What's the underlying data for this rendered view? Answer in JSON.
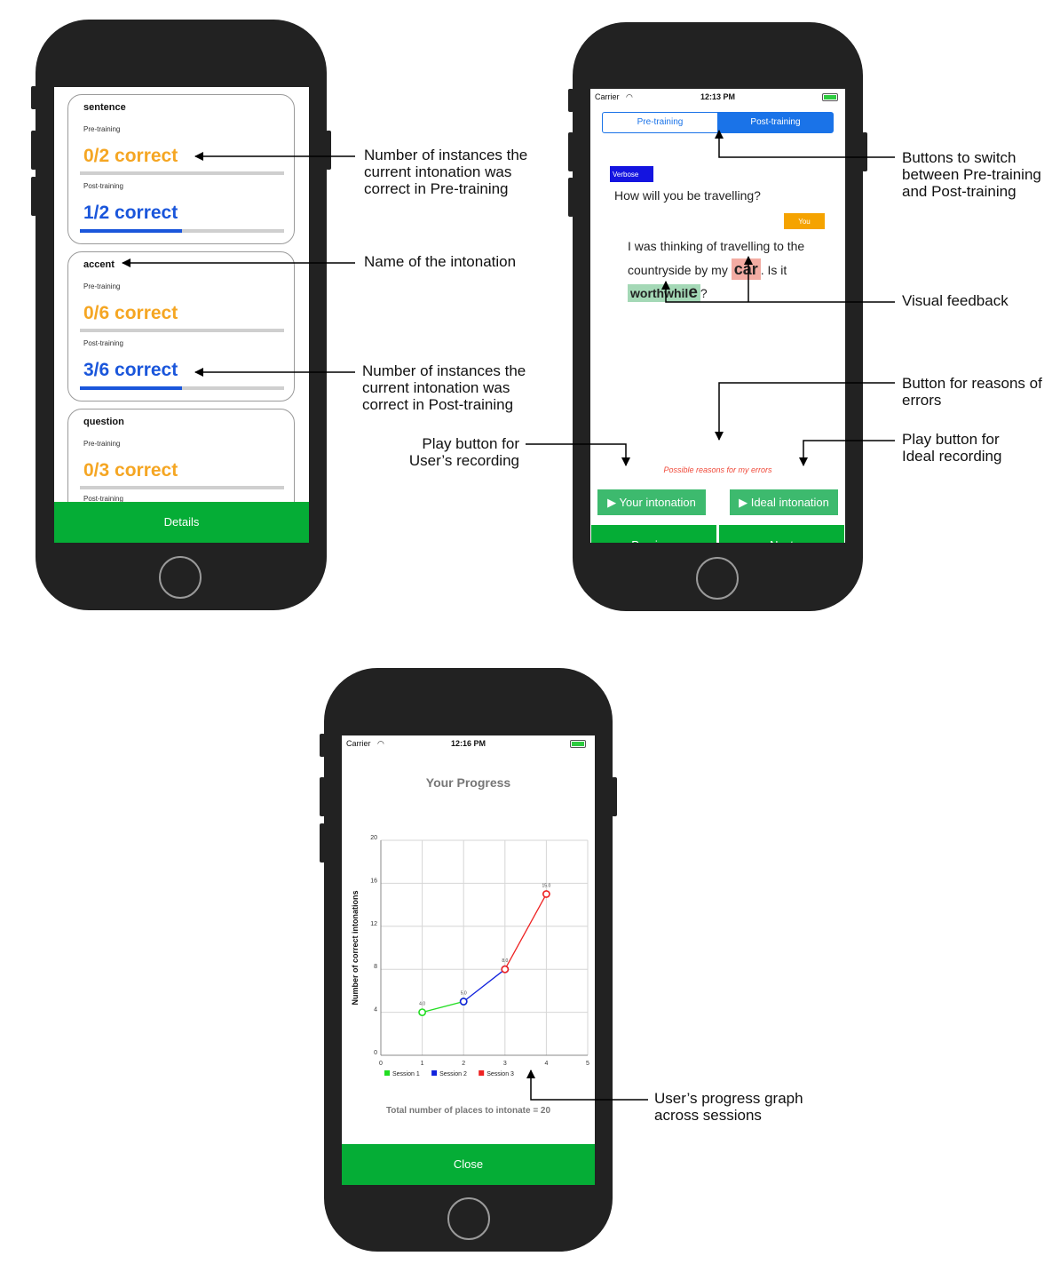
{
  "screen1": {
    "cards": [
      {
        "title": "sentence",
        "pre_label": "Pre-training",
        "pre_score": "0/2 correct",
        "post_label": "Post-training",
        "post_score": "1/2 correct",
        "pre_fraction": 0,
        "post_fraction": 0.5
      },
      {
        "title": "accent",
        "pre_label": "Pre-training",
        "pre_score": "0/6 correct",
        "post_label": "Post-training",
        "post_score": "3/6 correct",
        "pre_fraction": 0,
        "post_fraction": 0.5
      },
      {
        "title": "question",
        "pre_label": "Pre-training",
        "pre_score": "0/3 correct",
        "post_label": "Post-training",
        "pre_fraction": 0
      }
    ],
    "details_button": "Details"
  },
  "screen2": {
    "carrier": "Carrier",
    "time": "12:13 PM",
    "tabs": [
      "Pre-training",
      "Post-training"
    ],
    "verbose_tag": "Verbose",
    "question": "How will you be travelling?",
    "you_tag": "You",
    "answer_part1": "I was thinking of travelling to the countryside by my ",
    "answer_hl1": "car",
    "answer_part2": ". Is it ",
    "answer_hl2_a": "worthwhil",
    "answer_hl2_b": "e",
    "answer_part3": "?",
    "reasons_link": "Possible reasons for my errors",
    "your_intonation": "▶ Your intonation",
    "ideal_intonation": "▶ Ideal intonation",
    "previous": "Previous",
    "next": "Next"
  },
  "screen3": {
    "carrier": "Carrier",
    "time": "12:16 PM",
    "title": "Your Progress",
    "total_text": "Total number of places to intonate = 20",
    "close_button": "Close"
  },
  "chart_data": {
    "type": "line",
    "ylabel": "Number of correct intonations",
    "xlabel": "",
    "xlim": [
      0,
      5
    ],
    "ylim": [
      0,
      20
    ],
    "x_ticks": [
      "0",
      "1",
      "2",
      "3",
      "4",
      "5"
    ],
    "y_ticks": [
      "0",
      "4",
      "8",
      "12",
      "16",
      "20"
    ],
    "grid": true,
    "legend": "bottom",
    "series": [
      {
        "name": "Session 1",
        "color": "#22dd22",
        "x": [
          1,
          2
        ],
        "y": [
          4.0,
          5.0
        ],
        "labels": [
          "4.0",
          "5.0"
        ]
      },
      {
        "name": "Session 2",
        "color": "#1122dd",
        "x": [
          2,
          3
        ],
        "y": [
          5.0,
          8.0
        ],
        "labels": [
          "",
          "8.0"
        ]
      },
      {
        "name": "Session 3",
        "color": "#ee2222",
        "x": [
          3,
          4
        ],
        "y": [
          8.0,
          15.0
        ],
        "labels": [
          "",
          "15.0"
        ]
      }
    ]
  },
  "annotations": {
    "pre_count": "Number of instances the current intonation was correct in Pre-training",
    "name": "Name of the intonation",
    "post_count": "Number of instances the current intonation was correct in Post-training",
    "switch": "Buttons to switch between Pre-training and Post-training",
    "visual_feedback": "Visual feedback",
    "reasons": "Button for reasons of errors",
    "play_user": "Play button for User’s recording",
    "play_ideal": "Play button for Ideal recording",
    "graph": "User’s progress graph across sessions"
  },
  "colors": {
    "phone": "#222222",
    "green_button": "#05ad36",
    "play_button": "#3dba6e",
    "pre_score": "#f5a623",
    "post_score": "#1a56db",
    "tab_active": "#1a73e8"
  }
}
